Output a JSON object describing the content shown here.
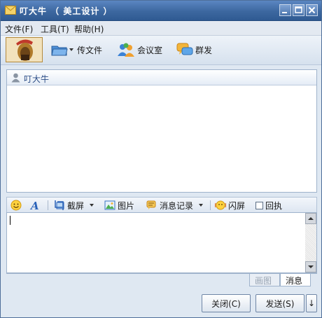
{
  "window": {
    "title": "叮大牛 （ 美工设计 ）",
    "controls": [
      "minimize",
      "maximize",
      "close"
    ]
  },
  "menu": {
    "items": [
      {
        "label": "文件(F)"
      },
      {
        "label": "工具(T)"
      },
      {
        "label": "帮助(H)"
      }
    ]
  },
  "toolbar": {
    "avatar_icon": "warrior-helmet-avatar",
    "file_transfer": "传文件",
    "meeting_room": "会议室",
    "group_send": "群发"
  },
  "history": {
    "contact_name": "叮大牛"
  },
  "input_toolbar": {
    "screenshot": "截屏",
    "image": "图片",
    "message_log": "消息记录",
    "shake": "闪屏",
    "receipt": "回执",
    "receipt_checked": false
  },
  "tabs": {
    "image": "画图",
    "message": "消息",
    "active": "消息"
  },
  "actions": {
    "close": "关闭(C)",
    "send": "发送(S)",
    "send_options": "↓"
  }
}
